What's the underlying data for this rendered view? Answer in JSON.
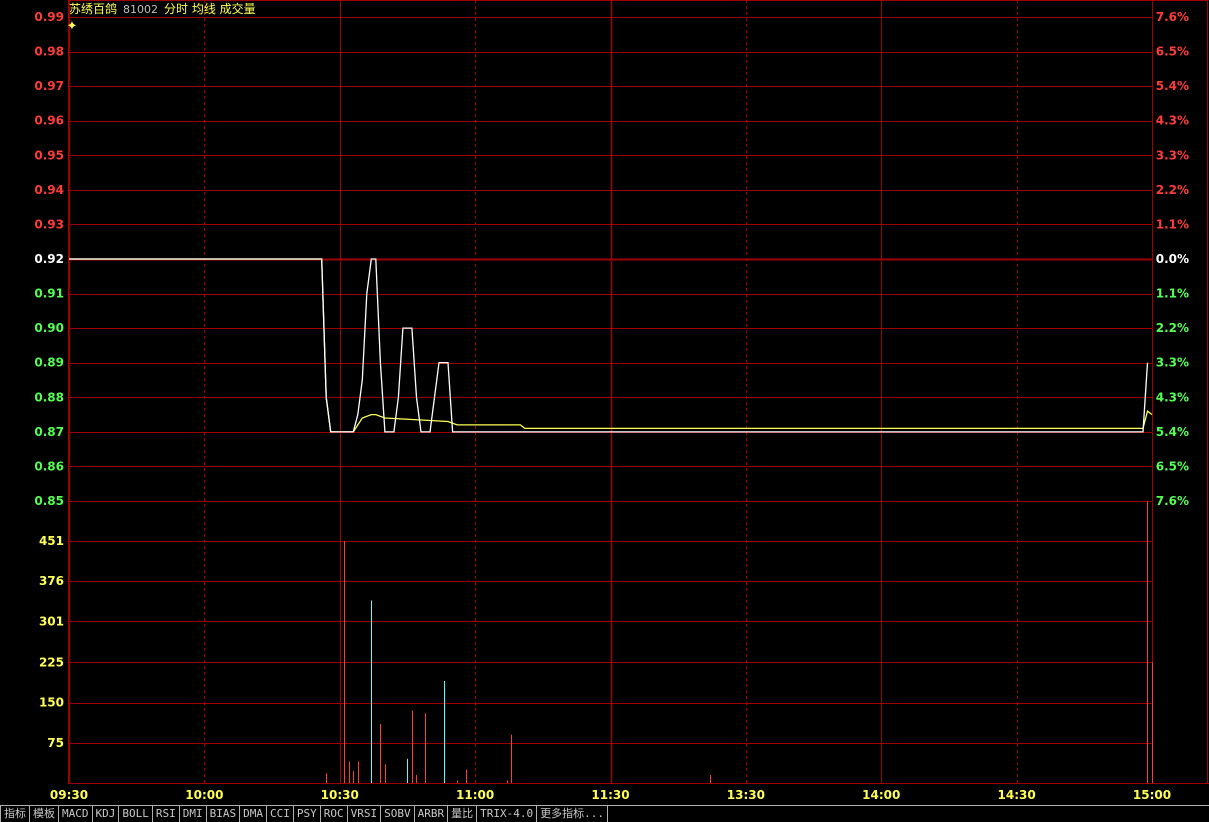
{
  "header": {
    "name": "苏绣百鸽",
    "code": "81002",
    "tags": "分时 均线 成交量"
  },
  "colors": {
    "up": "#ff3c3c",
    "down": "#54ff54",
    "flat": "#ffffff",
    "grid": "#a00000",
    "volume_label": "#ffff54",
    "time_label": "#ffff54",
    "price_line": "#ffffff",
    "avg_line": "#ffff54",
    "vol_up": "#ff3c3c",
    "vol_down": "#54ffff"
  },
  "price_axis": {
    "ticks": [
      "0.99",
      "0.98",
      "0.97",
      "0.96",
      "0.95",
      "0.94",
      "0.93",
      "0.92",
      "0.91",
      "0.90",
      "0.89",
      "0.88",
      "0.87",
      "0.86",
      "0.85"
    ],
    "pct_ticks": [
      "7.6%",
      "6.5%",
      "5.4%",
      "4.3%",
      "3.3%",
      "2.2%",
      "1.1%",
      "0.0%",
      "1.1%",
      "2.2%",
      "3.3%",
      "4.3%",
      "5.4%",
      "6.5%",
      "7.6%"
    ],
    "prev_close": 0.92,
    "min": 0.85,
    "max": 0.99
  },
  "volume_axis": {
    "ticks": [
      "451",
      "376",
      "301",
      "225",
      "150",
      "75"
    ],
    "max": 451
  },
  "time_axis": {
    "ticks": [
      "09:30",
      "10:00",
      "10:30",
      "11:00",
      "11:30",
      "13:30",
      "14:00",
      "14:30",
      "15:00"
    ]
  },
  "chart_data": {
    "type": "line",
    "minutes": 240,
    "price_series": [
      {
        "t": 0,
        "p": 0.92
      },
      {
        "t": 56,
        "p": 0.92
      },
      {
        "t": 57,
        "p": 0.88
      },
      {
        "t": 58,
        "p": 0.87
      },
      {
        "t": 63,
        "p": 0.87
      },
      {
        "t": 64,
        "p": 0.875
      },
      {
        "t": 65,
        "p": 0.885
      },
      {
        "t": 66,
        "p": 0.91
      },
      {
        "t": 67,
        "p": 0.92
      },
      {
        "t": 68,
        "p": 0.92
      },
      {
        "t": 69,
        "p": 0.89
      },
      {
        "t": 70,
        "p": 0.87
      },
      {
        "t": 72,
        "p": 0.87
      },
      {
        "t": 73,
        "p": 0.88
      },
      {
        "t": 74,
        "p": 0.9
      },
      {
        "t": 76,
        "p": 0.9
      },
      {
        "t": 77,
        "p": 0.88
      },
      {
        "t": 78,
        "p": 0.87
      },
      {
        "t": 80,
        "p": 0.87
      },
      {
        "t": 81,
        "p": 0.88
      },
      {
        "t": 82,
        "p": 0.89
      },
      {
        "t": 84,
        "p": 0.89
      },
      {
        "t": 85,
        "p": 0.87
      },
      {
        "t": 238,
        "p": 0.87
      },
      {
        "t": 239,
        "p": 0.89
      }
    ],
    "avg_series": [
      {
        "t": 0,
        "p": 0.92
      },
      {
        "t": 56,
        "p": 0.92
      },
      {
        "t": 57,
        "p": 0.88
      },
      {
        "t": 58,
        "p": 0.87
      },
      {
        "t": 63,
        "p": 0.87
      },
      {
        "t": 65,
        "p": 0.874
      },
      {
        "t": 67,
        "p": 0.875
      },
      {
        "t": 68,
        "p": 0.875
      },
      {
        "t": 70,
        "p": 0.874
      },
      {
        "t": 84,
        "p": 0.873
      },
      {
        "t": 86,
        "p": 0.872
      },
      {
        "t": 100,
        "p": 0.872
      },
      {
        "t": 101,
        "p": 0.871
      },
      {
        "t": 238,
        "p": 0.871
      },
      {
        "t": 239,
        "p": 0.876
      },
      {
        "t": 240,
        "p": 0.875
      }
    ],
    "volume_bars": [
      {
        "t": 57,
        "v": 18,
        "d": "up"
      },
      {
        "t": 61,
        "v": 451,
        "d": "up"
      },
      {
        "t": 62,
        "v": 40,
        "d": "up"
      },
      {
        "t": 63,
        "v": 22,
        "d": "up"
      },
      {
        "t": 64,
        "v": 40,
        "d": "up"
      },
      {
        "t": 67,
        "v": 340,
        "d": "down"
      },
      {
        "t": 69,
        "v": 110,
        "d": "up"
      },
      {
        "t": 70,
        "v": 35,
        "d": "up"
      },
      {
        "t": 75,
        "v": 45,
        "d": "down"
      },
      {
        "t": 76,
        "v": 135,
        "d": "up"
      },
      {
        "t": 77,
        "v": 15,
        "d": "up"
      },
      {
        "t": 79,
        "v": 130,
        "d": "up"
      },
      {
        "t": 83,
        "v": 190,
        "d": "down"
      },
      {
        "t": 86,
        "v": 5,
        "d": "up"
      },
      {
        "t": 88,
        "v": 25,
        "d": "up"
      },
      {
        "t": 98,
        "v": 90,
        "d": "up"
      },
      {
        "t": 97,
        "v": 5,
        "d": "up"
      },
      {
        "t": 142,
        "v": 15,
        "d": "up"
      },
      {
        "t": 239,
        "v": 525,
        "d": "up"
      },
      {
        "t": 240,
        "v": 225,
        "d": "up"
      }
    ]
  },
  "toolbar": {
    "tabs": [
      "指标",
      "模板",
      "MACD",
      "KDJ",
      "BOLL",
      "RSI",
      "DMI",
      "BIAS",
      "DMA",
      "CCI",
      "PSY",
      "ROC",
      "VRSI",
      "SOBV",
      "ARBR",
      "量比",
      "TRIX-4.0",
      "更多指标..."
    ]
  }
}
